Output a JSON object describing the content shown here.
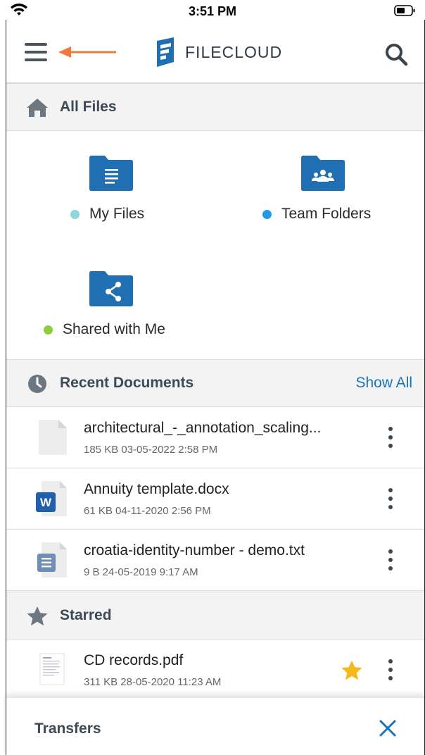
{
  "status": {
    "time": "3:51 PM"
  },
  "header": {
    "logo_text_light": "FILE",
    "logo_text_bold": "CLOUD"
  },
  "sections": {
    "all_files": "All Files",
    "recent": "Recent Documents",
    "recent_link": "Show All",
    "starred": "Starred"
  },
  "folders": [
    {
      "label": "My Files",
      "dot_color": "#8fd6dc",
      "icon": "folder-doc-icon"
    },
    {
      "label": "Team Folders",
      "dot_color": "#1e9bef",
      "icon": "folder-team-icon"
    },
    {
      "label": "Shared with Me",
      "dot_color": "#8ecf3b",
      "icon": "folder-share-icon"
    }
  ],
  "recent_files": [
    {
      "name": "architectural_-_annotation_scaling...",
      "meta": "185 KB 03-05-2022 2:58 PM",
      "icon": "blank-file-icon"
    },
    {
      "name": "Annuity template.docx",
      "meta": "61 KB 04-11-2020 2:56 PM",
      "icon": "word-file-icon"
    },
    {
      "name": "croatia-identity-number - demo.txt",
      "meta": "9 B 24-05-2019 9:17 AM",
      "icon": "text-file-icon"
    }
  ],
  "starred_files": [
    {
      "name": "CD records.pdf",
      "meta": "311 KB 28-05-2020 11:23 AM",
      "icon": "pdf-thumbnail-icon",
      "starred": true
    }
  ],
  "transfers": {
    "title": "Transfers"
  },
  "colors": {
    "accent": "#1a73b8",
    "folder": "#1f6fb2",
    "arrow": "#f07a3a",
    "star": "#f6b81a"
  }
}
